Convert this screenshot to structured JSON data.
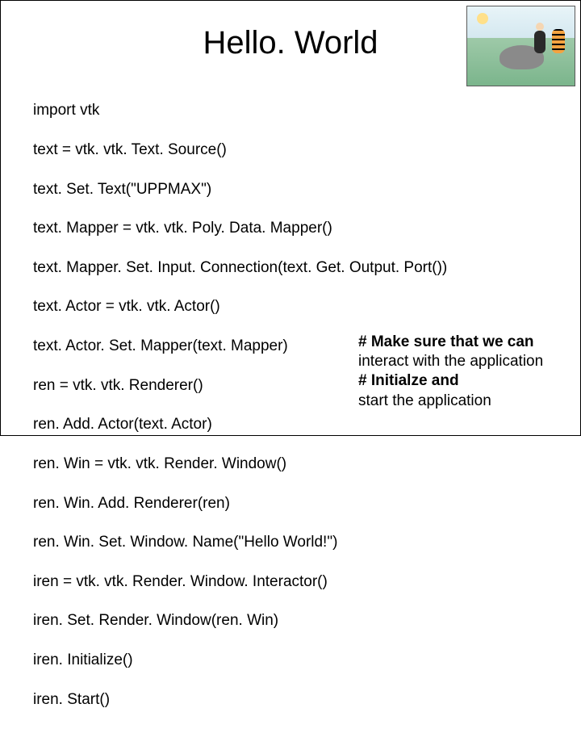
{
  "slide": {
    "title": "Hello. World",
    "code_lines": [
      "import vtk",
      "text = vtk. vtk. Text. Source()",
      "text. Set. Text(\"UPPMAX\")",
      "text. Mapper = vtk. vtk. Poly. Data. Mapper()",
      "text. Mapper. Set. Input. Connection(text. Get. Output. Port())",
      "text. Actor = vtk. vtk. Actor()",
      "text. Actor. Set. Mapper(text. Mapper)",
      "ren = vtk. vtk. Renderer()",
      "ren. Add. Actor(text. Actor)",
      "ren. Win = vtk. vtk. Render. Window()",
      "ren. Win. Add. Renderer(ren)",
      "ren. Win. Set. Window. Name(\"Hello World!\")",
      "iren = vtk. vtk. Render. Window. Interactor()",
      "iren. Set. Render. Window(ren. Win)",
      "iren. Initialize()",
      "iren. Start()"
    ],
    "comments": [
      {
        "bold": "# Make sure that we can",
        "rest": ""
      },
      {
        "bold": "",
        "rest": "interact with the application"
      },
      {
        "bold": "# Initialze and",
        "rest": ""
      },
      {
        "bold": "",
        "rest": "start the application"
      }
    ],
    "image_alt": "Calvin and Hobbes cartoon by a stream"
  }
}
